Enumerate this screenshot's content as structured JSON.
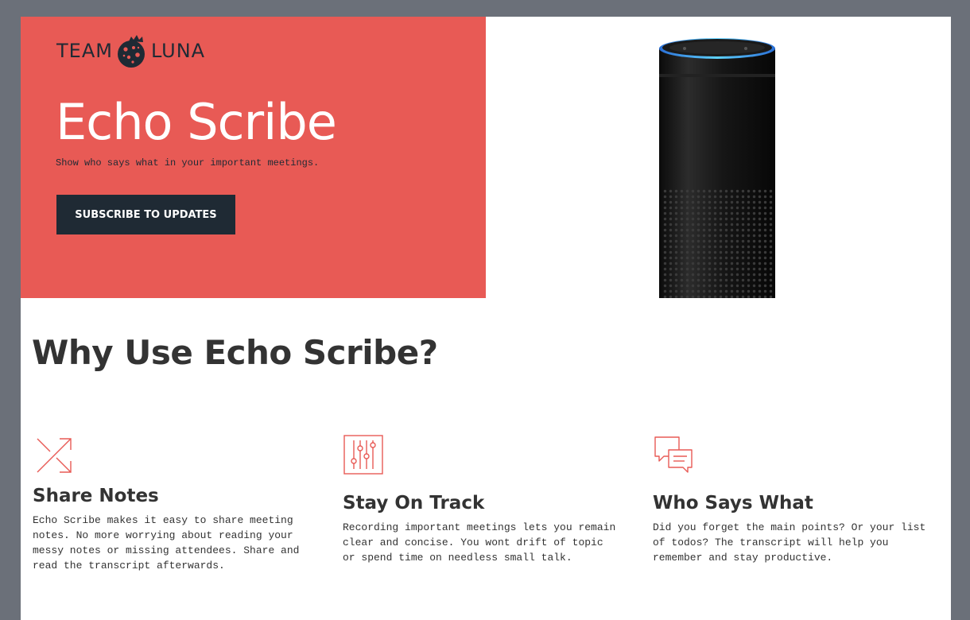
{
  "brand": {
    "team": "TEAM",
    "luna": "LUNA"
  },
  "hero": {
    "title": "Echo Scribe",
    "subtitle": "Show who says what in your important meetings.",
    "cta_label": "Subscribe to updates"
  },
  "why": {
    "title": "Why Use Echo Scribe?",
    "features": [
      {
        "icon": "share-arrows-icon",
        "title": "Share Notes",
        "text": "Echo Scribe makes it easy to share meeting notes. No more worrying about reading your messy notes or missing attendees. Share and read the transcript afterwards."
      },
      {
        "icon": "sliders-icon",
        "title": "Stay On Track",
        "text": "Recording important meetings lets you remain clear and concise. You wont drift of topic or spend time on needless small talk."
      },
      {
        "icon": "chat-bubbles-icon",
        "title": "Who Says What",
        "text": "Did you forget the main points? Or your list of todos? The transcript will help you remember and stay productive."
      }
    ]
  },
  "colors": {
    "accent": "#e85a55",
    "dark": "#1f2a34",
    "frame": "#6b7079"
  }
}
